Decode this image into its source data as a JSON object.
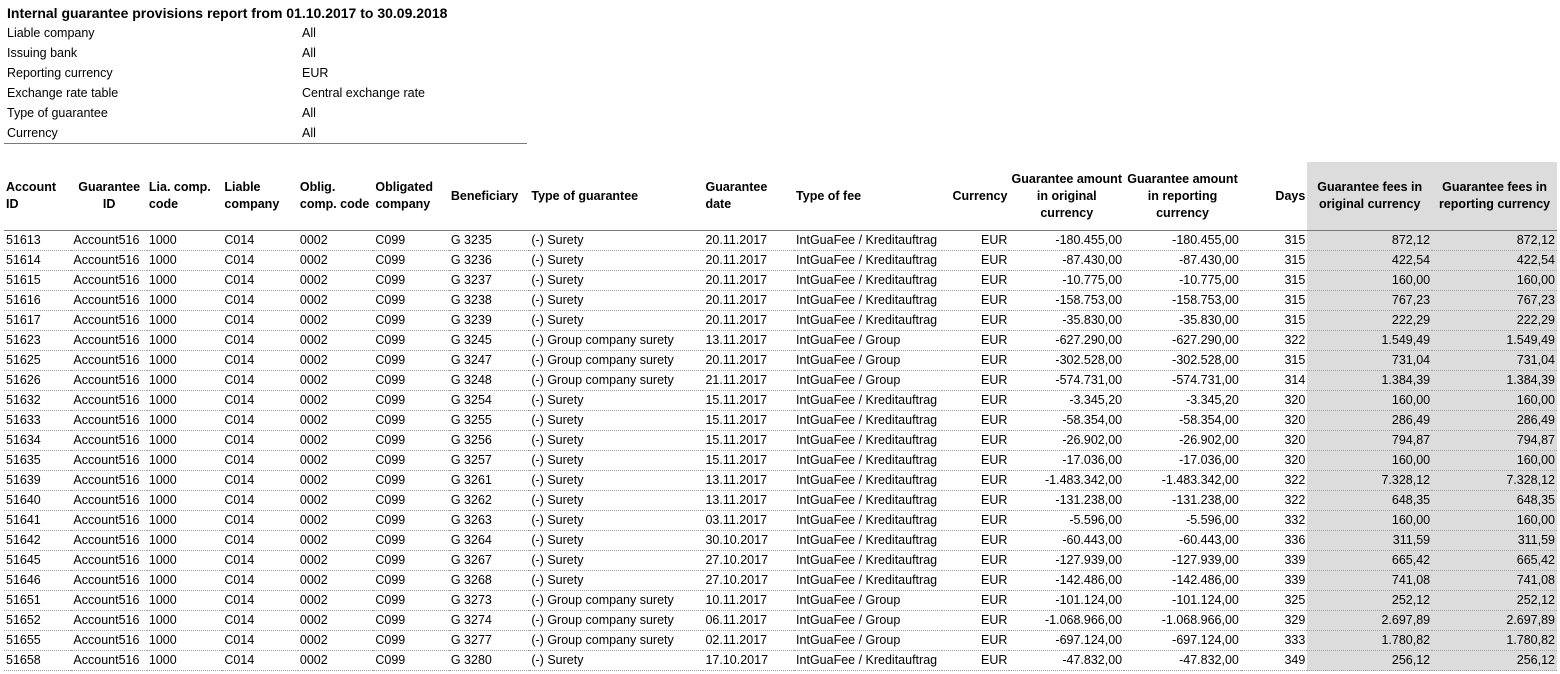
{
  "report": {
    "title": "Internal guarantee provisions report from 01.10.2017 to 30.09.2018",
    "params": [
      {
        "label": "Liable company",
        "value": "All"
      },
      {
        "label": "Issuing bank",
        "value": "All"
      },
      {
        "label": "Reporting currency",
        "value": "EUR"
      },
      {
        "label": "Exchange rate table",
        "value": "Central exchange rate"
      },
      {
        "label": "Type of guarantee",
        "value": "All"
      },
      {
        "label": "Currency",
        "value": "All"
      }
    ]
  },
  "table": {
    "columns": [
      "Account ID",
      "Guarantee ID",
      "Lia. comp. code",
      "Liable company",
      "Oblig. comp. code",
      "Obligated company",
      "Beneficiary",
      "Type of guarantee",
      "Guarantee date",
      "Type of fee",
      "Currency",
      "Guarantee amount in original currency",
      "Guarantee amount in reporting currency",
      "Days",
      "Guarantee fees in original currency",
      "Guarantee fees in reporting currency"
    ],
    "rows": [
      [
        "51613",
        "Account516",
        "1000",
        "C014",
        "0002",
        "C099",
        "G 3235",
        "(-) Surety",
        "20.11.2017",
        "IntGuaFee / Kreditauftrag",
        "EUR",
        "-180.455,00",
        "-180.455,00",
        "315",
        "872,12",
        "872,12"
      ],
      [
        "51614",
        "Account516",
        "1000",
        "C014",
        "0002",
        "C099",
        "G 3236",
        "(-) Surety",
        "20.11.2017",
        "IntGuaFee / Kreditauftrag",
        "EUR",
        "-87.430,00",
        "-87.430,00",
        "315",
        "422,54",
        "422,54"
      ],
      [
        "51615",
        "Account516",
        "1000",
        "C014",
        "0002",
        "C099",
        "G 3237",
        "(-) Surety",
        "20.11.2017",
        "IntGuaFee / Kreditauftrag",
        "EUR",
        "-10.775,00",
        "-10.775,00",
        "315",
        "160,00",
        "160,00"
      ],
      [
        "51616",
        "Account516",
        "1000",
        "C014",
        "0002",
        "C099",
        "G 3238",
        "(-) Surety",
        "20.11.2017",
        "IntGuaFee / Kreditauftrag",
        "EUR",
        "-158.753,00",
        "-158.753,00",
        "315",
        "767,23",
        "767,23"
      ],
      [
        "51617",
        "Account516",
        "1000",
        "C014",
        "0002",
        "C099",
        "G 3239",
        "(-) Surety",
        "20.11.2017",
        "IntGuaFee / Kreditauftrag",
        "EUR",
        "-35.830,00",
        "-35.830,00",
        "315",
        "222,29",
        "222,29"
      ],
      [
        "51623",
        "Account516",
        "1000",
        "C014",
        "0002",
        "C099",
        "G 3245",
        "(-) Group company surety",
        "13.11.2017",
        "IntGuaFee / Group",
        "EUR",
        "-627.290,00",
        "-627.290,00",
        "322",
        "1.549,49",
        "1.549,49"
      ],
      [
        "51625",
        "Account516",
        "1000",
        "C014",
        "0002",
        "C099",
        "G 3247",
        "(-) Group company surety",
        "20.11.2017",
        "IntGuaFee / Group",
        "EUR",
        "-302.528,00",
        "-302.528,00",
        "315",
        "731,04",
        "731,04"
      ],
      [
        "51626",
        "Account516",
        "1000",
        "C014",
        "0002",
        "C099",
        "G 3248",
        "(-) Group company surety",
        "21.11.2017",
        "IntGuaFee / Group",
        "EUR",
        "-574.731,00",
        "-574.731,00",
        "314",
        "1.384,39",
        "1.384,39"
      ],
      [
        "51632",
        "Account516",
        "1000",
        "C014",
        "0002",
        "C099",
        "G 3254",
        "(-) Surety",
        "15.11.2017",
        "IntGuaFee / Kreditauftrag",
        "EUR",
        "-3.345,20",
        "-3.345,20",
        "320",
        "160,00",
        "160,00"
      ],
      [
        "51633",
        "Account516",
        "1000",
        "C014",
        "0002",
        "C099",
        "G 3255",
        "(-) Surety",
        "15.11.2017",
        "IntGuaFee / Kreditauftrag",
        "EUR",
        "-58.354,00",
        "-58.354,00",
        "320",
        "286,49",
        "286,49"
      ],
      [
        "51634",
        "Account516",
        "1000",
        "C014",
        "0002",
        "C099",
        "G 3256",
        "(-) Surety",
        "15.11.2017",
        "IntGuaFee / Kreditauftrag",
        "EUR",
        "-26.902,00",
        "-26.902,00",
        "320",
        "794,87",
        "794,87"
      ],
      [
        "51635",
        "Account516",
        "1000",
        "C014",
        "0002",
        "C099",
        "G 3257",
        "(-) Surety",
        "15.11.2017",
        "IntGuaFee / Kreditauftrag",
        "EUR",
        "-17.036,00",
        "-17.036,00",
        "320",
        "160,00",
        "160,00"
      ],
      [
        "51639",
        "Account516",
        "1000",
        "C014",
        "0002",
        "C099",
        "G 3261",
        "(-) Surety",
        "13.11.2017",
        "IntGuaFee / Kreditauftrag",
        "EUR",
        "-1.483.342,00",
        "-1.483.342,00",
        "322",
        "7.328,12",
        "7.328,12"
      ],
      [
        "51640",
        "Account516",
        "1000",
        "C014",
        "0002",
        "C099",
        "G 3262",
        "(-) Surety",
        "13.11.2017",
        "IntGuaFee / Kreditauftrag",
        "EUR",
        "-131.238,00",
        "-131.238,00",
        "322",
        "648,35",
        "648,35"
      ],
      [
        "51641",
        "Account516",
        "1000",
        "C014",
        "0002",
        "C099",
        "G 3263",
        "(-) Surety",
        "03.11.2017",
        "IntGuaFee / Kreditauftrag",
        "EUR",
        "-5.596,00",
        "-5.596,00",
        "332",
        "160,00",
        "160,00"
      ],
      [
        "51642",
        "Account516",
        "1000",
        "C014",
        "0002",
        "C099",
        "G 3264",
        "(-) Surety",
        "30.10.2017",
        "IntGuaFee / Kreditauftrag",
        "EUR",
        "-60.443,00",
        "-60.443,00",
        "336",
        "311,59",
        "311,59"
      ],
      [
        "51645",
        "Account516",
        "1000",
        "C014",
        "0002",
        "C099",
        "G 3267",
        "(-) Surety",
        "27.10.2017",
        "IntGuaFee / Kreditauftrag",
        "EUR",
        "-127.939,00",
        "-127.939,00",
        "339",
        "665,42",
        "665,42"
      ],
      [
        "51646",
        "Account516",
        "1000",
        "C014",
        "0002",
        "C099",
        "G 3268",
        "(-) Surety",
        "27.10.2017",
        "IntGuaFee / Kreditauftrag",
        "EUR",
        "-142.486,00",
        "-142.486,00",
        "339",
        "741,08",
        "741,08"
      ],
      [
        "51651",
        "Account516",
        "1000",
        "C014",
        "0002",
        "C099",
        "G 3273",
        "(-) Group company surety",
        "10.11.2017",
        "IntGuaFee / Group",
        "EUR",
        "-101.124,00",
        "-101.124,00",
        "325",
        "252,12",
        "252,12"
      ],
      [
        "51652",
        "Account516",
        "1000",
        "C014",
        "0002",
        "C099",
        "G 3274",
        "(-) Group company surety",
        "06.11.2017",
        "IntGuaFee / Group",
        "EUR",
        "-1.068.966,00",
        "-1.068.966,00",
        "329",
        "2.697,89",
        "2.697,89"
      ],
      [
        "51655",
        "Account516",
        "1000",
        "C014",
        "0002",
        "C099",
        "G 3277",
        "(-) Group company surety",
        "02.11.2017",
        "IntGuaFee / Group",
        "EUR",
        "-697.124,00",
        "-697.124,00",
        "333",
        "1.780,82",
        "1.780,82"
      ],
      [
        "51658",
        "Account516",
        "1000",
        "C014",
        "0002",
        "C099",
        "G 3280",
        "(-) Surety",
        "17.10.2017",
        "IntGuaFee / Kreditauftrag",
        "EUR",
        "-47.832,00",
        "-47.832,00",
        "349",
        "256,12",
        "256,12"
      ]
    ]
  },
  "colors": {
    "shaded_column_bg": "#dcdcdc",
    "rule_line": "#7a7a7a"
  }
}
